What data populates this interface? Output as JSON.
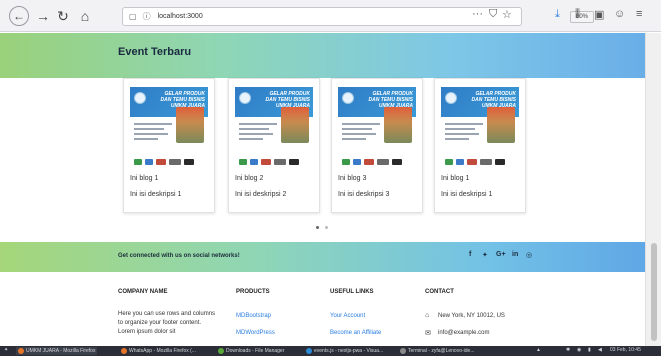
{
  "browser": {
    "url": "localhost:3000",
    "zoom": "80%",
    "icons": [
      "back-icon",
      "forward-icon",
      "reload-icon",
      "home-icon",
      "info-icon",
      "more-icon",
      "pocket-icon",
      "bookmark-star-icon",
      "download-icon",
      "library-icon",
      "sidebar-icon",
      "account-icon",
      "menu-icon"
    ]
  },
  "events": {
    "title": "Event Terbaru",
    "poster_caption": "GELAR PRODUK DAN TEMU BISNIS UMKM JUARA",
    "cards": [
      {
        "title": "Ini blog 1",
        "desc": "Ini isi deskripsi 1"
      },
      {
        "title": "Ini blog 2",
        "desc": "Ini isi deskripsi 2"
      },
      {
        "title": "Ini blog 3",
        "desc": "Ini isi deskripsi 3"
      },
      {
        "title": "Ini blog 1",
        "desc": "Ini isi deskripsi 1"
      }
    ]
  },
  "social": {
    "text": "Get connected with us on social networks!",
    "icons": [
      "f",
      "✦",
      "G+",
      "in",
      "◎"
    ]
  },
  "footer": {
    "company": {
      "heading": "COMPANY NAME",
      "text": "Here you can use rows and columns to organize your footer content. Lorem ipsum dolor sit"
    },
    "products": {
      "heading": "PRODUCTS",
      "links": [
        "MDBootstrap",
        "MDWordPress"
      ]
    },
    "useful": {
      "heading": "USEFUL LINKS",
      "links": [
        "Your Account",
        "Become an Affiliate"
      ]
    },
    "contact": {
      "heading": "CONTACT",
      "address": "New York, NY 10012, US",
      "email": "info@example.com"
    }
  },
  "taskbar": {
    "tasks": [
      "UMKM JUARA - Mozilla Firefox",
      "WhatsApp - Mozilla Firefox (...",
      "Downloads - File Manager",
      "events.js - nextjs-pwa - Visua...",
      "Terminal - zyfa@Lenovo-ide..."
    ],
    "date": "03 Feb, 10:45"
  },
  "colors": {
    "accent": "#2a7de1",
    "banner_start": "#9ad17a",
    "banner_end": "#6aaee8",
    "taskbar": "#2b2e36"
  }
}
